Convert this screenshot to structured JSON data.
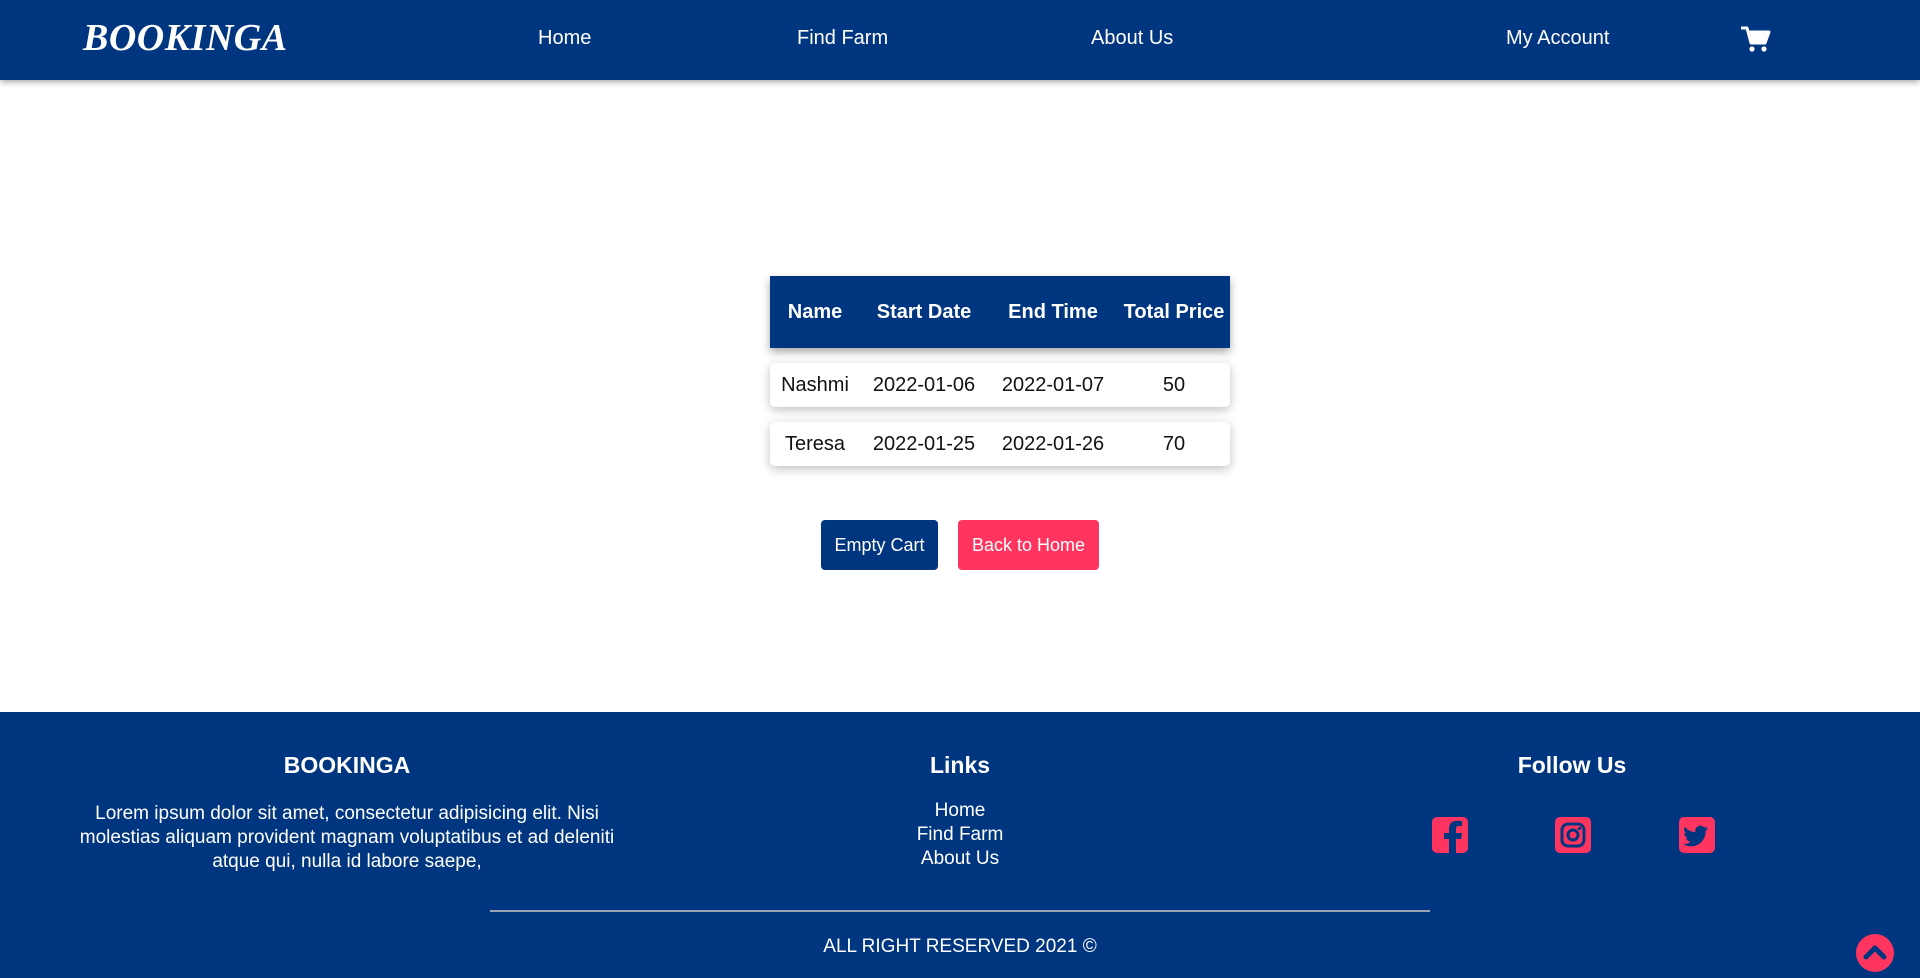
{
  "brand": "BOOKINGA",
  "nav": {
    "home": "Home",
    "find_farm": "Find Farm",
    "about": "About Us",
    "account": "My Account"
  },
  "cart": {
    "headers": [
      "Name",
      "Start Date",
      "End Time",
      "Total Price"
    ],
    "rows": [
      {
        "name": "Nashmi",
        "start": "2022-01-06",
        "end": "2022-01-07",
        "price": "50"
      },
      {
        "name": "Teresa",
        "start": "2022-01-25",
        "end": "2022-01-26",
        "price": "70"
      }
    ]
  },
  "buttons": {
    "empty": "Empty Cart",
    "back": "Back to Home"
  },
  "footer": {
    "brand_title": "BOOKINGA",
    "about_text": "Lorem ipsum dolor sit amet, consectetur adipisicing elit. Nisi molestias aliquam provident magnam voluptatibus et ad deleniti atque qui, nulla id labore saepe,",
    "links_title": "Links",
    "links": [
      "Home",
      "Find Farm",
      "About Us"
    ],
    "follow_title": "Follow Us",
    "copyright": "ALL RIGHT RESERVED 2021 ©"
  },
  "icons": {
    "cart": "cart-icon",
    "facebook": "facebook-icon",
    "instagram": "instagram-icon",
    "twitter": "twitter-icon",
    "scroll_top": "chevron-up-icon"
  },
  "colors": {
    "primary": "#00367f",
    "accent": "#ff3560",
    "white": "#ffffff"
  }
}
